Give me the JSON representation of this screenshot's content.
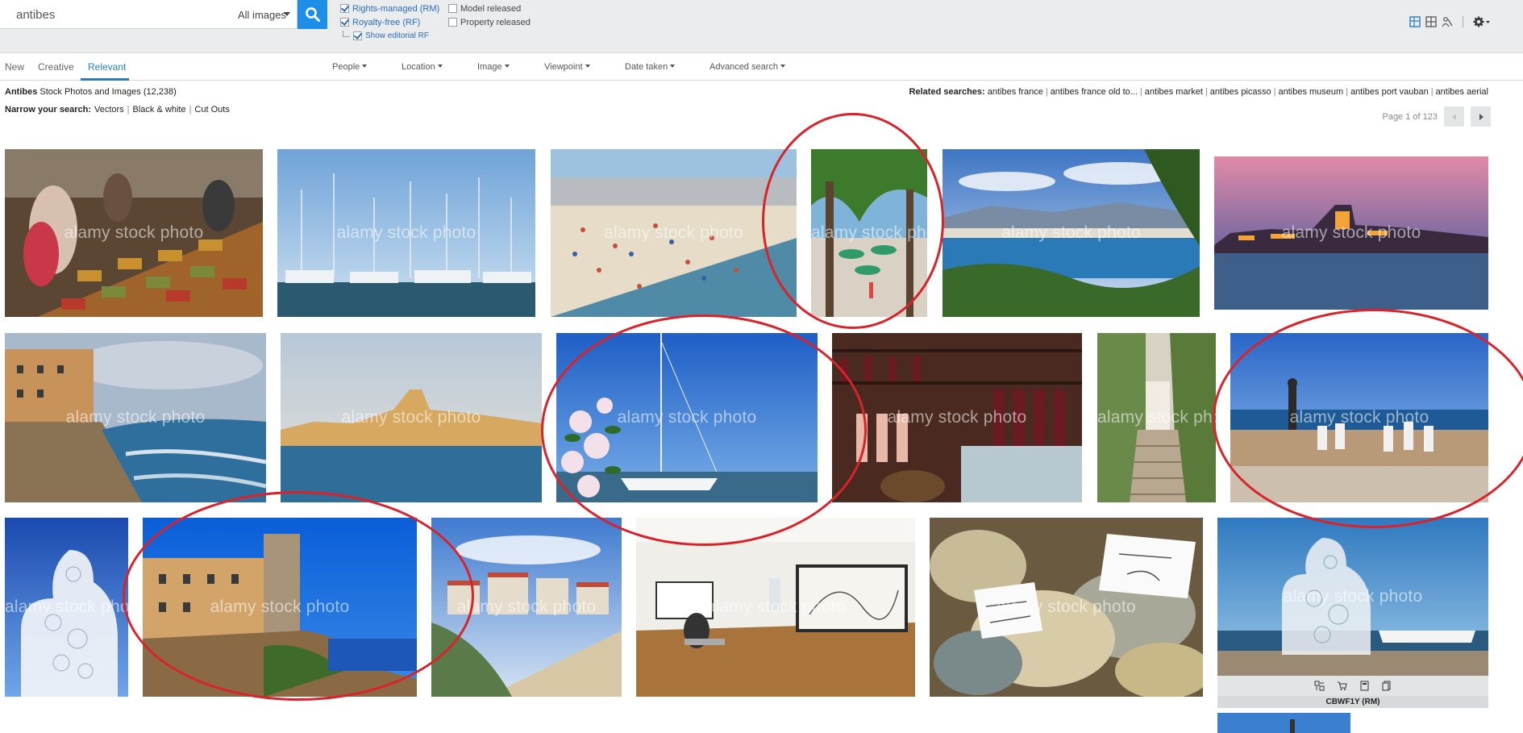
{
  "search": {
    "query": "antibes",
    "scope": "All images"
  },
  "filters": [
    {
      "label": "Rights-managed (RM)",
      "checked": true
    },
    {
      "label": "Royalty-free (RF)",
      "checked": true
    },
    {
      "label": "Show editorial RF",
      "checked": true
    },
    {
      "label": "Model released",
      "checked": false
    },
    {
      "label": "Property released",
      "checked": false
    }
  ],
  "sort_tabs": [
    "New",
    "Creative",
    "Relevant"
  ],
  "facets": [
    "People",
    "Location",
    "Image",
    "Viewpoint",
    "Date taken",
    "Advanced search"
  ],
  "results": {
    "title_bold": "Antibes",
    "title_rest": "Stock Photos and Images (12,238)",
    "narrow_label": "Narrow your search:",
    "narrow_links": [
      "Vectors",
      "Black & white",
      "Cut Outs"
    ],
    "related_label": "Related searches:",
    "related_links": [
      "antibes france",
      "antibes france old to...",
      "antibes market",
      "antibes picasso",
      "antibes museum",
      "antibes port vauban",
      "antibes aerial"
    ],
    "page_text": "Page 1 of 123"
  },
  "watermark": "alamy stock photo",
  "hover_ref": "CBWF1Y  (RM)",
  "colors": {
    "accent": "#1e8ee8",
    "link": "#2a6ebb",
    "annotation": "#d9232a"
  }
}
